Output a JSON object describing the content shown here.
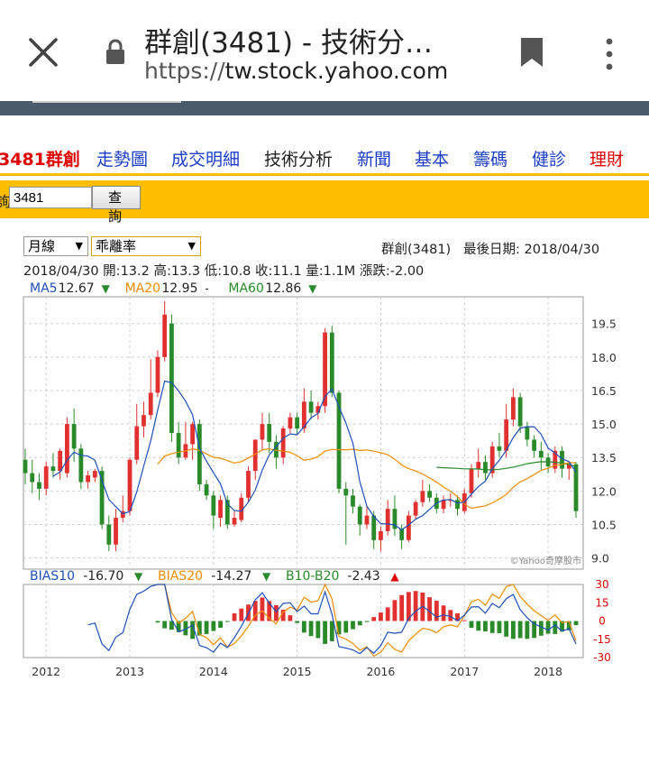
{
  "browser": {
    "tab_title": "群創(3481) - 技術分…",
    "url_scheme": "https://",
    "url_host": "tw.stock.yahoo.com"
  },
  "nav": {
    "items": [
      {
        "label": "3481群創",
        "color": "#e00000",
        "bold": true,
        "x": -2
      },
      {
        "label": "走勢圖",
        "color": "#1a3cc8",
        "x": 107
      },
      {
        "label": "成交明細",
        "color": "#1a3cc8",
        "x": 190
      },
      {
        "label": "技術分析",
        "color": "#222222",
        "x": 293
      },
      {
        "label": "新聞",
        "color": "#1a3cc8",
        "x": 396
      },
      {
        "label": "基本",
        "color": "#1a3cc8",
        "x": 460
      },
      {
        "label": "籌碼",
        "color": "#1a3cc8",
        "x": 525
      },
      {
        "label": "健診",
        "color": "#1a3cc8",
        "x": 590
      },
      {
        "label": "理財",
        "color": "#e00000",
        "x": 654
      }
    ]
  },
  "query": {
    "label": "詢",
    "input_value": "3481",
    "button": "查 詢"
  },
  "controls": {
    "period_select": "月線",
    "indicator_select": "乖離率"
  },
  "info": {
    "stock": "群創(3481)",
    "last_date": "最後日期: 2018/04/30",
    "ohlc": "2018/04/30  開:13.2  高:13.3  低:10.8  收:11.1  量:1.1M  漲跌:-2.00"
  },
  "ma_legend": [
    {
      "label": "MA5",
      "value": "12.67",
      "mark": "▼",
      "color": "#1f4fb8",
      "mark_color": "#2a8a2a"
    },
    {
      "label": "MA20",
      "value": "12.95",
      "mark": "-",
      "color": "#f08c00",
      "mark_color": "#222"
    },
    {
      "label": "MA60",
      "value": "12.86",
      "mark": "▼",
      "color": "#2a8a2a",
      "mark_color": "#2a8a2a"
    }
  ],
  "bias_legend": [
    {
      "label": "BIAS10",
      "value": "-16.70",
      "mark": "▼",
      "color": "#1f4fb8",
      "mark_color": "#2a8a2a"
    },
    {
      "label": "BIAS20",
      "value": "-14.27",
      "mark": "▼",
      "color": "#f08c00",
      "mark_color": "#2a8a2a"
    },
    {
      "label": "B10-B20",
      "value": "-2.43",
      "mark": "▲",
      "color": "#2a8a2a",
      "mark_color": "#e00000"
    }
  ],
  "watermark": "©Yahoo奇摩股市",
  "colors": {
    "up": "#e03030",
    "down": "#2a8a2a",
    "ma5": "#1f4fb8",
    "ma20": "#f08c00",
    "ma60": "#2a8a2a",
    "grid": "#d0d0d0"
  },
  "chart_data": {
    "type": "candlestick",
    "period": "monthly",
    "x_ticks": [
      "2012",
      "2013",
      "2014",
      "2015",
      "2016",
      "2017",
      "2018"
    ],
    "y_ticks": [
      9.0,
      10.5,
      12.0,
      13.5,
      15.0,
      16.5,
      18.0,
      19.5
    ],
    "ylim": [
      8.5,
      20.7
    ],
    "candles": [
      {
        "o": 13.4,
        "h": 13.9,
        "l": 12.3,
        "c": 12.8
      },
      {
        "o": 12.8,
        "h": 13.4,
        "l": 11.9,
        "c": 12.4
      },
      {
        "o": 12.4,
        "h": 12.8,
        "l": 11.6,
        "c": 12.1
      },
      {
        "o": 12.1,
        "h": 13.3,
        "l": 11.8,
        "c": 13.1
      },
      {
        "o": 13.1,
        "h": 13.7,
        "l": 12.6,
        "c": 12.9
      },
      {
        "o": 12.9,
        "h": 13.9,
        "l": 12.5,
        "c": 13.8
      },
      {
        "o": 12.8,
        "h": 15.3,
        "l": 12.6,
        "c": 15.0
      },
      {
        "o": 15.0,
        "h": 15.7,
        "l": 13.3,
        "c": 13.9
      },
      {
        "o": 13.9,
        "h": 14.1,
        "l": 12.1,
        "c": 12.4
      },
      {
        "o": 12.4,
        "h": 12.9,
        "l": 12.1,
        "c": 12.7
      },
      {
        "o": 12.6,
        "h": 13.0,
        "l": 12.4,
        "c": 12.9
      },
      {
        "o": 12.9,
        "h": 13.1,
        "l": 10.3,
        "c": 10.5
      },
      {
        "o": 10.5,
        "h": 10.9,
        "l": 9.3,
        "c": 9.6
      },
      {
        "o": 9.6,
        "h": 11.2,
        "l": 9.3,
        "c": 10.8
      },
      {
        "o": 10.8,
        "h": 11.8,
        "l": 10.6,
        "c": 11.1
      },
      {
        "o": 11.1,
        "h": 13.5,
        "l": 10.9,
        "c": 13.4
      },
      {
        "o": 13.4,
        "h": 15.9,
        "l": 13.2,
        "c": 14.9
      },
      {
        "o": 14.9,
        "h": 16.0,
        "l": 14.4,
        "c": 15.4
      },
      {
        "o": 15.4,
        "h": 17.9,
        "l": 15.2,
        "c": 16.4
      },
      {
        "o": 16.4,
        "h": 18.3,
        "l": 16.2,
        "c": 18.0
      },
      {
        "o": 18.0,
        "h": 20.5,
        "l": 17.8,
        "c": 19.9
      },
      {
        "o": 19.5,
        "h": 19.9,
        "l": 14.2,
        "c": 14.6
      },
      {
        "o": 14.6,
        "h": 15.1,
        "l": 13.2,
        "c": 13.5
      },
      {
        "o": 13.5,
        "h": 15.1,
        "l": 13.4,
        "c": 14.1
      },
      {
        "o": 14.1,
        "h": 15.1,
        "l": 13.4,
        "c": 15.0
      },
      {
        "o": 15.0,
        "h": 15.2,
        "l": 12.0,
        "c": 12.3
      },
      {
        "o": 12.3,
        "h": 12.5,
        "l": 11.6,
        "c": 11.8
      },
      {
        "o": 11.8,
        "h": 12.0,
        "l": 10.3,
        "c": 10.9
      },
      {
        "o": 10.8,
        "h": 11.8,
        "l": 10.4,
        "c": 11.6
      },
      {
        "o": 11.6,
        "h": 11.8,
        "l": 10.3,
        "c": 10.5
      },
      {
        "o": 10.5,
        "h": 11.1,
        "l": 10.4,
        "c": 10.8
      },
      {
        "o": 10.7,
        "h": 11.9,
        "l": 10.6,
        "c": 11.7
      },
      {
        "o": 11.7,
        "h": 13.1,
        "l": 11.5,
        "c": 12.9
      },
      {
        "o": 12.9,
        "h": 14.0,
        "l": 12.5,
        "c": 14.3
      },
      {
        "o": 14.3,
        "h": 15.5,
        "l": 13.8,
        "c": 15.0
      },
      {
        "o": 15.0,
        "h": 15.5,
        "l": 13.7,
        "c": 14.2
      },
      {
        "o": 14.2,
        "h": 14.5,
        "l": 13.0,
        "c": 13.5
      },
      {
        "o": 13.5,
        "h": 14.9,
        "l": 13.2,
        "c": 14.8
      },
      {
        "o": 14.8,
        "h": 15.5,
        "l": 14.6,
        "c": 15.3
      },
      {
        "o": 15.3,
        "h": 15.5,
        "l": 14.5,
        "c": 14.8
      },
      {
        "o": 14.8,
        "h": 16.6,
        "l": 14.6,
        "c": 16.0
      },
      {
        "o": 16.0,
        "h": 16.5,
        "l": 15.2,
        "c": 15.5
      },
      {
        "o": 15.5,
        "h": 16.0,
        "l": 15.2,
        "c": 15.8
      },
      {
        "o": 15.8,
        "h": 19.3,
        "l": 15.5,
        "c": 19.1
      },
      {
        "o": 19.1,
        "h": 19.4,
        "l": 16.2,
        "c": 16.4
      },
      {
        "o": 16.4,
        "h": 16.5,
        "l": 11.9,
        "c": 12.1
      },
      {
        "o": 12.1,
        "h": 12.4,
        "l": 9.6,
        "c": 11.8
      },
      {
        "o": 11.8,
        "h": 12.1,
        "l": 11.0,
        "c": 11.3
      },
      {
        "o": 11.3,
        "h": 11.4,
        "l": 10.0,
        "c": 10.5
      },
      {
        "o": 10.5,
        "h": 11.3,
        "l": 10.3,
        "c": 10.9
      },
      {
        "o": 10.9,
        "h": 11.1,
        "l": 9.4,
        "c": 9.8
      },
      {
        "o": 9.8,
        "h": 10.4,
        "l": 9.3,
        "c": 10.2
      },
      {
        "o": 10.2,
        "h": 11.6,
        "l": 10.0,
        "c": 11.2
      },
      {
        "o": 11.2,
        "h": 11.8,
        "l": 10.0,
        "c": 10.3
      },
      {
        "o": 10.3,
        "h": 10.5,
        "l": 9.4,
        "c": 9.8
      },
      {
        "o": 9.8,
        "h": 11.1,
        "l": 9.7,
        "c": 10.9
      },
      {
        "o": 10.9,
        "h": 11.6,
        "l": 10.7,
        "c": 11.5
      },
      {
        "o": 11.5,
        "h": 12.5,
        "l": 11.3,
        "c": 12.0
      },
      {
        "o": 12.0,
        "h": 12.3,
        "l": 11.5,
        "c": 11.7
      },
      {
        "o": 11.7,
        "h": 11.9,
        "l": 11.0,
        "c": 11.2
      },
      {
        "o": 11.2,
        "h": 11.8,
        "l": 11.0,
        "c": 11.6
      },
      {
        "o": 11.6,
        "h": 11.9,
        "l": 11.3,
        "c": 11.6
      },
      {
        "o": 11.6,
        "h": 11.8,
        "l": 10.9,
        "c": 11.2
      },
      {
        "o": 11.1,
        "h": 12.1,
        "l": 11.0,
        "c": 11.9
      },
      {
        "o": 11.9,
        "h": 13.2,
        "l": 11.7,
        "c": 13.0
      },
      {
        "o": 13.0,
        "h": 13.9,
        "l": 12.6,
        "c": 13.3
      },
      {
        "o": 13.3,
        "h": 13.6,
        "l": 12.5,
        "c": 12.8
      },
      {
        "o": 12.8,
        "h": 14.2,
        "l": 12.6,
        "c": 14.0
      },
      {
        "o": 14.0,
        "h": 14.6,
        "l": 13.5,
        "c": 13.8
      },
      {
        "o": 13.8,
        "h": 15.9,
        "l": 13.5,
        "c": 15.2
      },
      {
        "o": 15.2,
        "h": 16.6,
        "l": 14.9,
        "c": 16.2
      },
      {
        "o": 16.2,
        "h": 16.4,
        "l": 14.6,
        "c": 14.9
      },
      {
        "o": 14.9,
        "h": 15.1,
        "l": 14.0,
        "c": 14.3
      },
      {
        "o": 14.3,
        "h": 14.5,
        "l": 13.5,
        "c": 13.8
      },
      {
        "o": 13.8,
        "h": 14.2,
        "l": 12.9,
        "c": 13.5
      },
      {
        "o": 13.5,
        "h": 13.7,
        "l": 12.8,
        "c": 13.1
      },
      {
        "o": 13.0,
        "h": 14.0,
        "l": 12.8,
        "c": 13.8
      },
      {
        "o": 13.8,
        "h": 14.0,
        "l": 12.6,
        "c": 13.0
      },
      {
        "o": 13.0,
        "h": 13.3,
        "l": 12.5,
        "c": 13.2
      },
      {
        "o": 13.2,
        "h": 13.3,
        "l": 10.8,
        "c": 11.1
      }
    ],
    "bias": {
      "ylim": [
        -30,
        30
      ],
      "y_ticks": [
        30,
        15,
        0,
        -15,
        -30
      ]
    }
  }
}
